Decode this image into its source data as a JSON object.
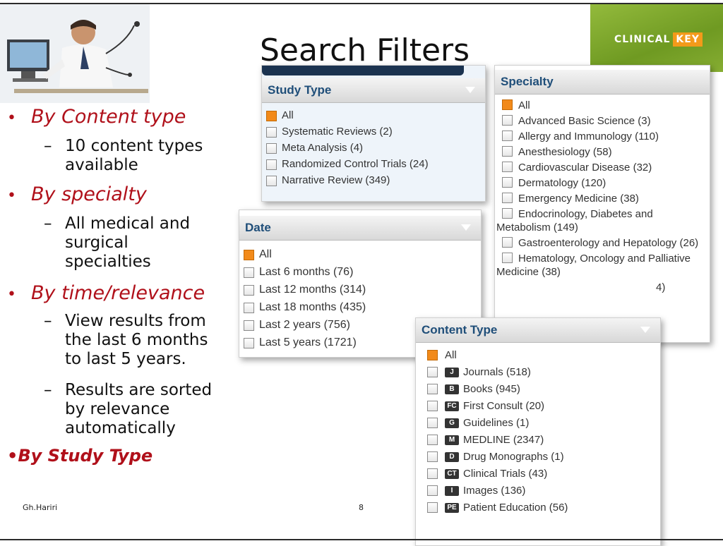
{
  "title": "Search Filters",
  "brand": {
    "text": "CLINICAL",
    "key": "KEY"
  },
  "bullets": [
    {
      "label": "By Content type",
      "subs": [
        "10 content types available"
      ]
    },
    {
      "label": "By specialty",
      "subs": [
        "All medical and surgical specialties"
      ]
    },
    {
      "label": "By time/relevance",
      "subs": [
        "View results from the last 6 months to last 5 years.",
        "Results are sorted by relevance automatically"
      ]
    },
    {
      "label": "By Study Type",
      "subs": []
    }
  ],
  "footer": {
    "author": "Gh.Hariri",
    "page": "8"
  },
  "panels": {
    "study": {
      "title": "Study Type",
      "items": [
        "All",
        "Systematic Reviews (2)",
        "Meta Analysis (4)",
        "Randomized Control Trials (24)",
        "Narrative Review (349)"
      ]
    },
    "specialty": {
      "title": "Specialty",
      "items": [
        "All",
        "Advanced Basic Science (3)",
        "Allergy and Immunology (110)",
        "Anesthesiology (58)",
        "Cardiovascular Disease (32)",
        "Dermatology (120)",
        "Emergency Medicine (38)",
        "Endocrinology, Diabetes and Metabolism (149)",
        "Gastroenterology and Hepatology (26)",
        "Hematology, Oncology and Palliative Medicine (38)",
        "4)"
      ]
    },
    "date": {
      "title": "Date",
      "items": [
        "All",
        "Last 6 months (76)",
        "Last 12 months (314)",
        "Last 18 months (435)",
        "Last 2 years (756)",
        "Last 5 years (1721)"
      ]
    },
    "content": {
      "title": "Content Type",
      "all": "All",
      "items": [
        {
          "icon": "J",
          "label": "Journals (518)"
        },
        {
          "icon": "B",
          "label": "Books (945)"
        },
        {
          "icon": "FC",
          "label": "First Consult (20)"
        },
        {
          "icon": "G",
          "label": "Guidelines (1)"
        },
        {
          "icon": "M",
          "label": "MEDLINE (2347)"
        },
        {
          "icon": "D",
          "label": "Drug Monographs (1)"
        },
        {
          "icon": "CT",
          "label": "Clinical Trials (43)"
        },
        {
          "icon": "I",
          "label": "Images (136)"
        },
        {
          "icon": "PE",
          "label": "Patient Education (56)"
        }
      ]
    }
  },
  "colors": {
    "bullet": "#b0101a",
    "panel_title": "#1f4e79",
    "checkbox_on": "#f28a1a",
    "brand_green": "#7aa62a",
    "brand_orange": "#f39a1a"
  }
}
